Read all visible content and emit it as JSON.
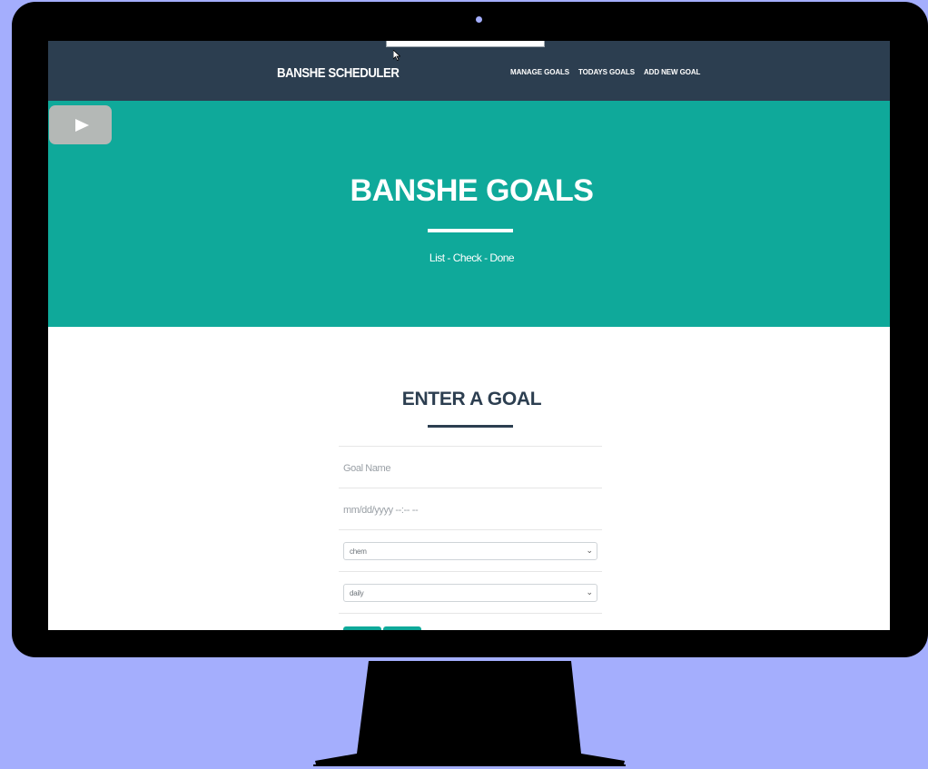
{
  "navbar": {
    "brand": "BANSHE SCHEDULER",
    "links": [
      "MANAGE GOALS",
      "TODAYS GOALS",
      "ADD NEW GOAL"
    ]
  },
  "hero": {
    "title": "BANSHE GOALS",
    "subtitle": "List - Check - Done"
  },
  "form": {
    "title": "ENTER A GOAL",
    "goal_name_placeholder": "Goal Name",
    "datetime_placeholder": "mm/dd/yyyy --:-- --",
    "category_value": "chem",
    "frequency_value": "daily"
  },
  "colors": {
    "navbar": "#2c3e50",
    "accent": "#0fa99a",
    "background": "#a4aefd"
  },
  "icons": {
    "play": "play-icon",
    "cursor": "mouse-cursor-icon",
    "chevron": "chevron-down-icon"
  }
}
